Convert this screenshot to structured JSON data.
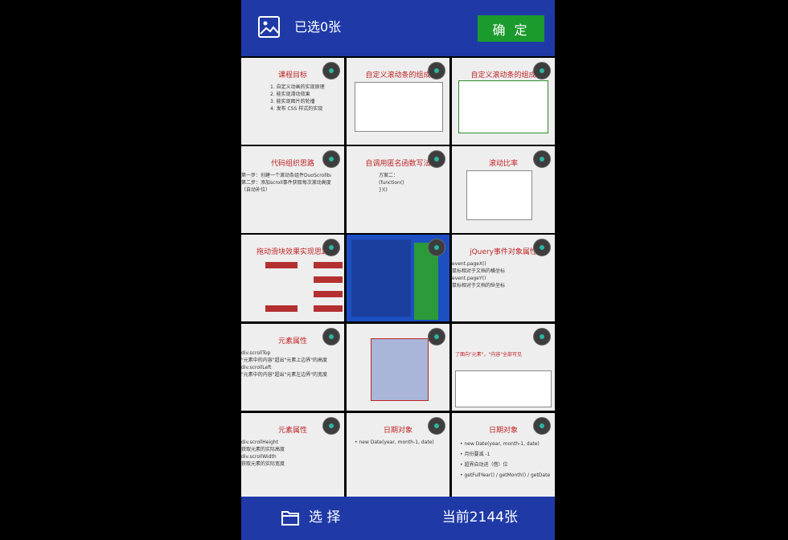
{
  "header": {
    "selected_text": "已选0张",
    "confirm_label": "确 定"
  },
  "grid": {
    "cells": [
      {
        "title": "课程目标",
        "lines": [
          "1. 自定义动画的实现原理",
          "2. 能实现滑动效果",
          "3. 能实现图片的轮播",
          "4. 发布 CSS 样式的实现"
        ]
      },
      {
        "title": "自定义滚动条的组成",
        "lines": []
      },
      {
        "title": "自定义滚动条的组成",
        "lines": []
      },
      {
        "title": "代码组织思路",
        "lines": [
          "第一步：创建一个滚动条组件DuoScrollbar",
          "第二步：添加scroll事件获取每次滚动高度",
          "（自动补位）"
        ]
      },
      {
        "title": "自调用匿名函数写法",
        "lines": [
          "方案二：",
          "(function()",
          "})()"
        ]
      },
      {
        "title": "滚动比率",
        "lines": []
      },
      {
        "title": "拖动滑块效果实现思路",
        "lines": []
      },
      {
        "title": "",
        "lines": []
      },
      {
        "title": "jQuery事件对象属性",
        "lines": [
          "event.pageX()",
          "  鼠标相对于文档的横坐标",
          "",
          "event.pageY()",
          "  鼠标相对于文档的纵坐标"
        ]
      },
      {
        "title": "元素属性",
        "lines": [
          "div.scrollTop",
          "  \"元素中的内容\"超出\"元素上边界\"的高度",
          "div.scrollLeft",
          "  \"元素中的内容\"超出\"元素左边界\"的宽度"
        ]
      },
      {
        "title": "",
        "lines": []
      },
      {
        "title": "",
        "lines": [
          "了面向\"元素\"，\"内容\"全部可见"
        ]
      },
      {
        "title": "元素属性",
        "lines": [
          "div.scrollHeight",
          "  获取元素的实际高度",
          "div.scrollWidth",
          "  获取元素的实际宽度"
        ]
      },
      {
        "title": "日期对象",
        "lines": [
          "• new Date(year, month-1, date)"
        ]
      },
      {
        "title": "日期对象",
        "lines": [
          "• new Date(year, month-1, date)",
          "• 月份要减 -1",
          "• 超界自动进（借）位",
          "• getFullYear() / getMonth() / getDate()"
        ]
      }
    ]
  },
  "footer": {
    "select_label": "选 择",
    "current_text": "当前2144张"
  },
  "colors": {
    "bar": "#1f3aa7",
    "confirm": "#1b9a2d",
    "title_red": "#c02424"
  }
}
